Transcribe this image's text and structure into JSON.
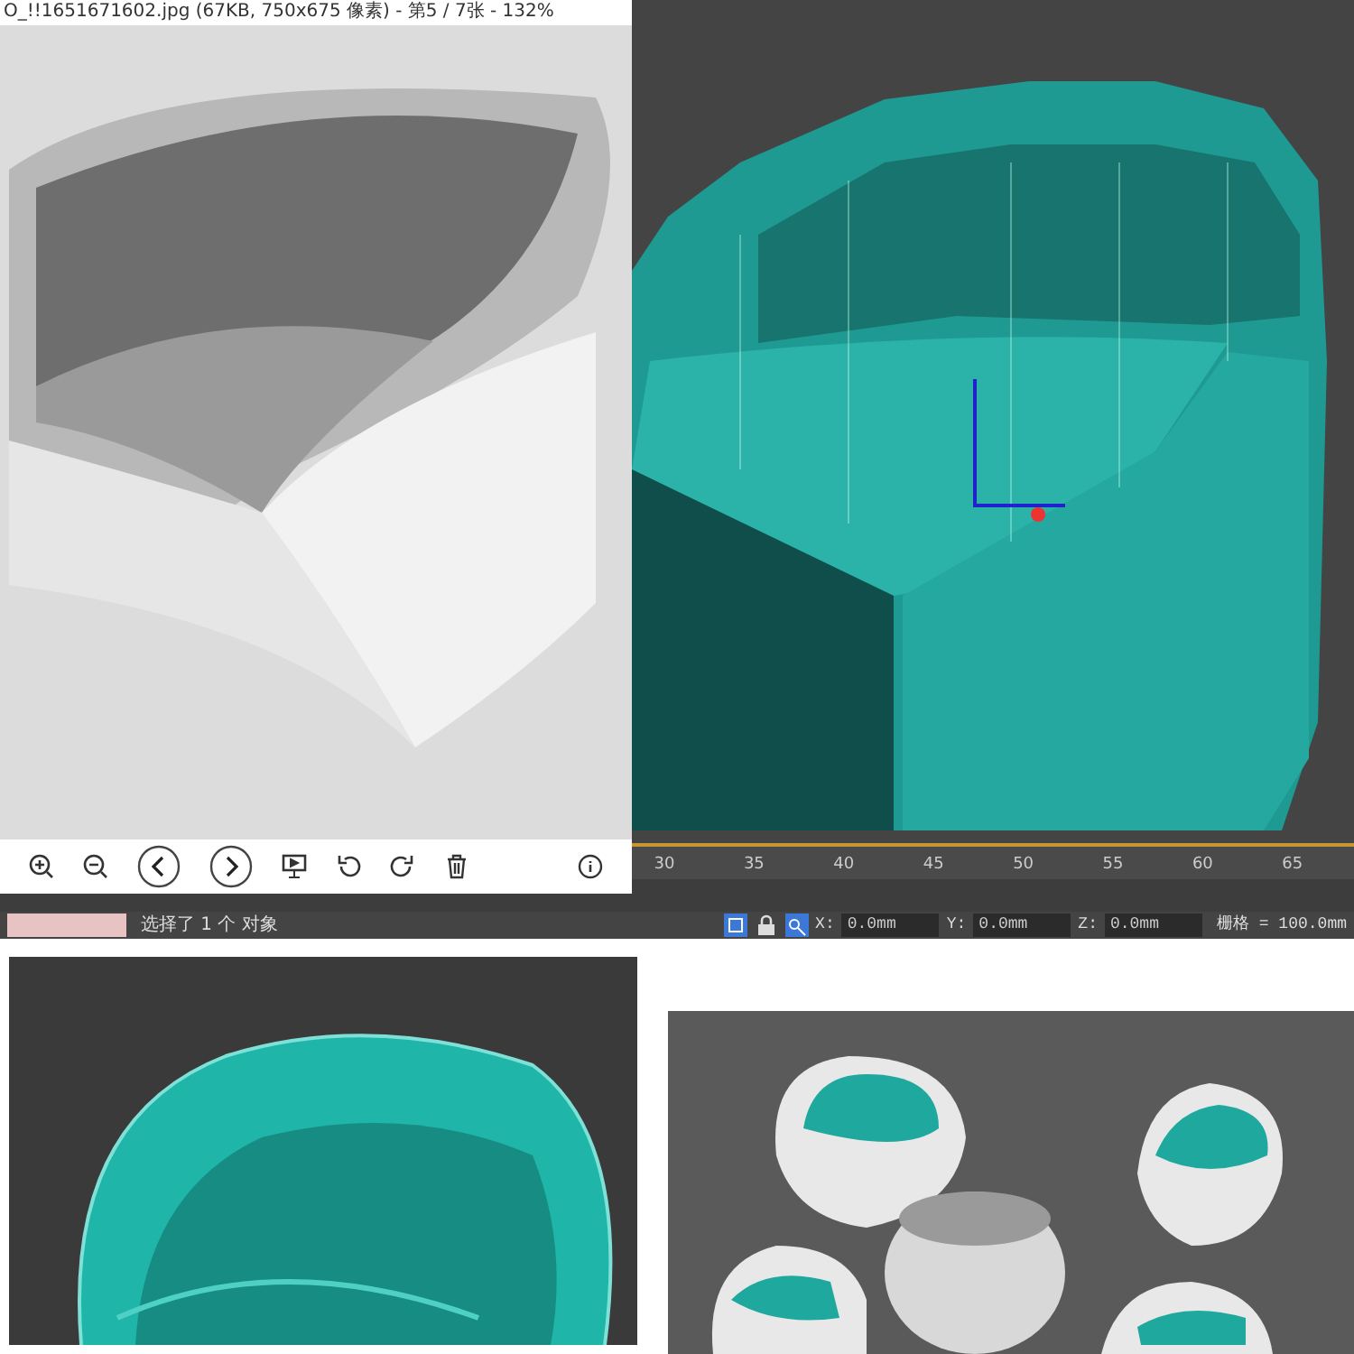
{
  "viewer": {
    "title": "O_!!1651671602.jpg (67KB, 750x675 像素) - 第5 / 7张 - 132%"
  },
  "timeline": {
    "ticks": [
      "30",
      "35",
      "40",
      "45",
      "50",
      "55",
      "60",
      "65"
    ]
  },
  "status_bar": {
    "prompt": "选择了 1 个 对象",
    "coords": [
      {
        "axis": "X:",
        "value": "0.0mm"
      },
      {
        "axis": "Y:",
        "value": "0.0mm"
      },
      {
        "axis": "Z:",
        "value": "0.0mm"
      }
    ],
    "grid": "栅格 = 100.0mm"
  }
}
